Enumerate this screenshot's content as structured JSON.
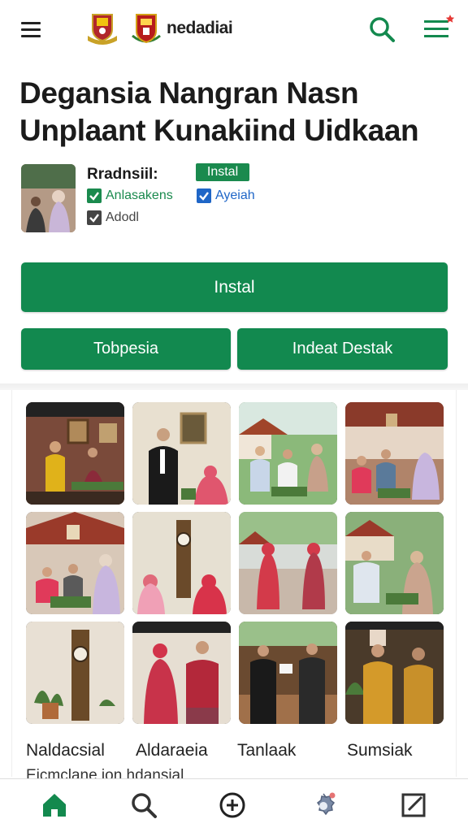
{
  "header": {
    "brand": "nedadiai",
    "menu_icon": "hamburger-menu-icon",
    "search_icon": "search-icon",
    "list_icon": "list-notification-icon"
  },
  "page": {
    "title_line1": "Degansia Nangran Nasn",
    "title_line2": "Unplaant Kunakiind Uidkaan"
  },
  "meta": {
    "label": "Rradnsiil:",
    "badge": "Instal",
    "checks": [
      {
        "label": "Anlasakens",
        "color": "#1a8a4e"
      },
      {
        "label": "Ayeiah",
        "color": "#1f66c7"
      },
      {
        "label": "Adodl",
        "color": "#444444"
      }
    ]
  },
  "buttons": {
    "main": "Instal",
    "left": "Tobpesia",
    "right": "Indeat Destak"
  },
  "gallery": {
    "captions": [
      "Naldacsial",
      "Aldaraeia",
      "Tanlaak",
      "Sumsiak"
    ],
    "subcaption": "Eicmclane ion hdansial"
  },
  "nav": {
    "items": [
      "home-icon",
      "search-icon",
      "add-circle-icon",
      "settings-gear-icon",
      "edit-note-icon"
    ],
    "active_color": "#13894e"
  },
  "colors": {
    "accent": "#12894f",
    "badge": "#1a8a4e"
  }
}
